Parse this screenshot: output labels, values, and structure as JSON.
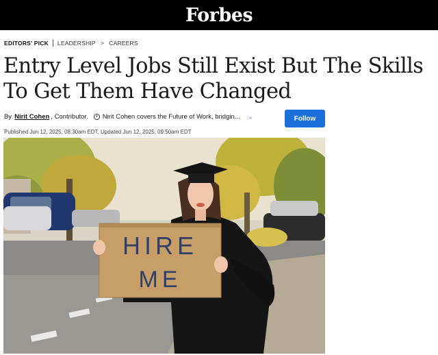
{
  "header": {
    "logo": "Forbes"
  },
  "breadcrumb": {
    "pick": "EDITORS' PICK",
    "section": "LEADERSHIP",
    "chevron": ">",
    "subsection": "CAREERS"
  },
  "article": {
    "title": "Entry Level Jobs Still Exist But The Skills To Get Them Have Changed",
    "byline": {
      "by": "By",
      "author": "Nirit Cohen",
      "role": ", Contributor.",
      "description": "Nirit Cohen covers the Future of Work, bridgin...",
      "follow_label": "Follow"
    },
    "published": "Published Jun 12, 2025, 08:30am EDT, Updated Jun 12, 2025, 09:50am EDT",
    "image": {
      "sign_line1": "HIRE",
      "sign_line2": "ME"
    }
  },
  "icons": [
    "clock-icon",
    "chevron-down-icon",
    "chevron-right-icon"
  ],
  "colors": {
    "accent": "#1a6fd8",
    "topbar": "#000000"
  }
}
